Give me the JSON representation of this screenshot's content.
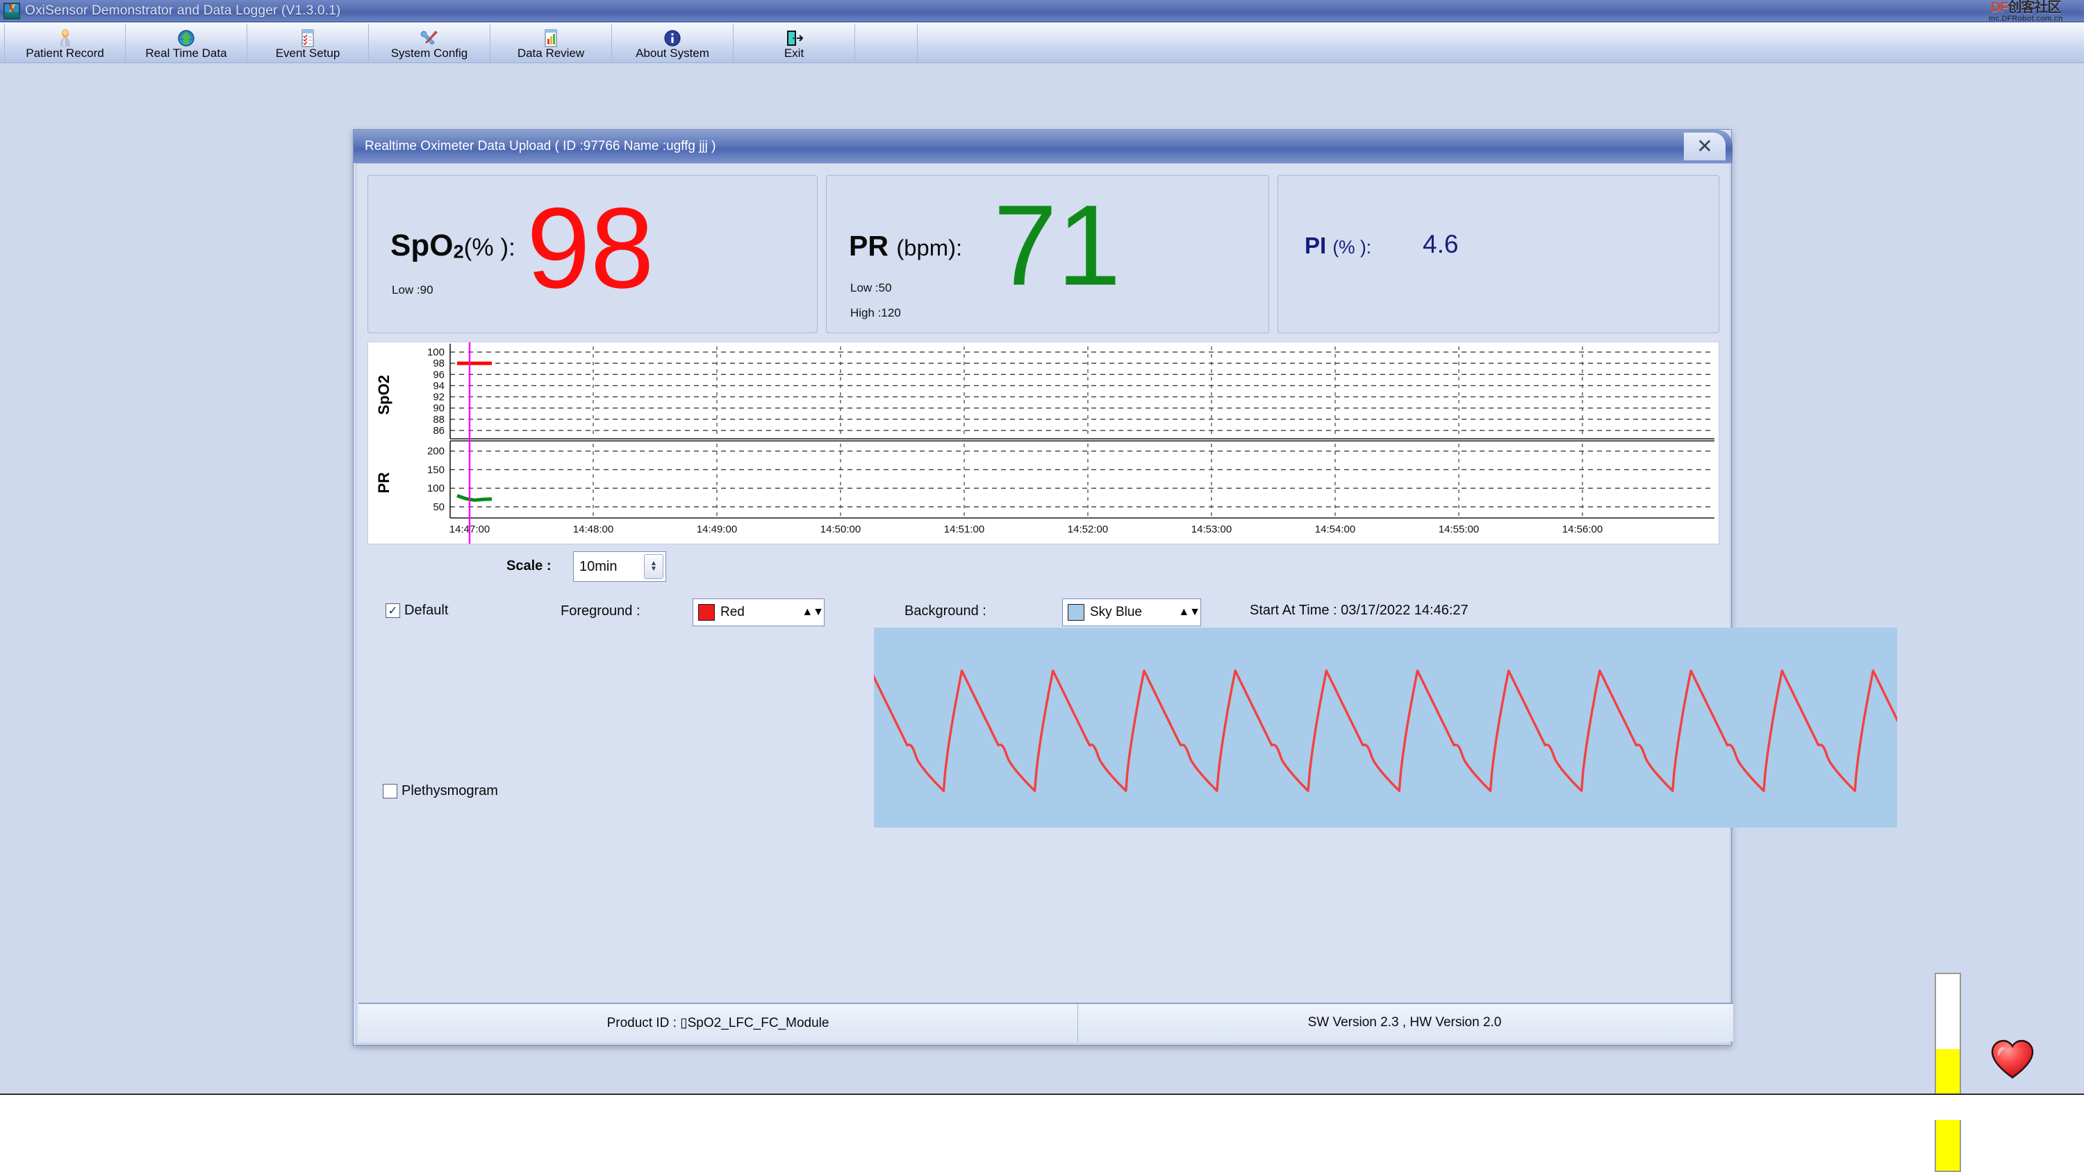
{
  "app": {
    "title": "OxiSensor Demonstrator and Data Logger (V1.3.0.1)",
    "icon": "app-logo-icon"
  },
  "watermark": {
    "brand": "DF",
    "brand_cn": "创客社区",
    "url": "mc.DFRobot.com.cn"
  },
  "toolbar": {
    "items": [
      {
        "label": "Patient Record",
        "icon": "person-icon"
      },
      {
        "label": "Real Time Data",
        "icon": "globe-arrow-icon"
      },
      {
        "label": "Event Setup",
        "icon": "checklist-icon"
      },
      {
        "label": "System Config",
        "icon": "wrench-screwdriver-icon"
      },
      {
        "label": "Data Review",
        "icon": "bar-chart-document-icon"
      },
      {
        "label": "About System",
        "icon": "info-circle-icon"
      },
      {
        "label": "Exit",
        "icon": "exit-door-icon"
      }
    ]
  },
  "dialog": {
    "title": "Realtime Oximeter Data Upload   ( ID :97766   Name :ugffg jjj )",
    "close_label": "✕",
    "patient": {
      "id": "97766",
      "name": "ugffg jjj"
    }
  },
  "readouts": {
    "spo2": {
      "label_main": "SpO",
      "label_sub": "2",
      "label_unit": "(% ):",
      "value": "98",
      "low": "Low :90",
      "color": "#ff0d0d"
    },
    "pr": {
      "label_main": "PR",
      "label_unit": "(bpm):",
      "value": "71",
      "low": "Low :50",
      "high": "High :120",
      "color": "#0f8a19"
    },
    "pi": {
      "label_main": "PI",
      "label_unit": "(% ):",
      "value": "4.6",
      "color": "#141d7a"
    }
  },
  "chart_data": [
    {
      "type": "line",
      "title": "SpO2 trend",
      "ylabel": "SpO2",
      "xlabel": "",
      "ylim": [
        85,
        101
      ],
      "yticks": [
        100,
        98,
        96,
        94,
        92,
        90,
        88,
        86
      ],
      "x": [
        "14:46:27",
        "14:46:40",
        "14:46:55",
        "14:47:10",
        "14:47:20"
      ],
      "values": [
        98,
        98,
        98,
        98,
        98
      ],
      "series_color": "#ff0000",
      "grid": true,
      "cursor_time": "14:47:00",
      "cursor_color": "#ff00ff"
    },
    {
      "type": "line",
      "title": "PR trend",
      "ylabel": "PR",
      "xlabel": "",
      "ylim": [
        20,
        220
      ],
      "yticks": [
        200,
        150,
        100,
        50
      ],
      "x": [
        "14:46:27",
        "14:46:40",
        "14:46:55",
        "14:47:10",
        "14:47:20"
      ],
      "values": [
        80,
        72,
        68,
        70,
        71
      ],
      "series_color": "#0a8a16",
      "grid": true,
      "cursor_time": "14:47:00",
      "cursor_color": "#ff00ff"
    }
  ],
  "chart_axis": {
    "xticks": [
      "14:47:00",
      "14:48:00",
      "14:49:00",
      "14:50:00",
      "14:51:00",
      "14:52:00",
      "14:53:00",
      "14:54:00",
      "14:55:00",
      "14:56:00"
    ]
  },
  "controls": {
    "scale_label": "Scale :",
    "scale_value": "10min",
    "default_checkbox": {
      "label": "Default",
      "checked": true,
      "mark": "✓"
    },
    "pleth_checkbox": {
      "label": "Plethysmogram",
      "checked": false,
      "mark": ""
    },
    "foreground": {
      "label": "Foreground :",
      "value": "Red",
      "color": "#ef1a1a"
    },
    "background": {
      "label": "Background :",
      "value": "Sky Blue",
      "color": "#a6cbe8"
    },
    "start_at_time": "Start At Time : 03/17/2022   14:46:27"
  },
  "pleth": {
    "wave_color": "#f4413f",
    "bg_color": "#a9cceb",
    "beats": 11
  },
  "indicators": {
    "signal_bar_percent": 62,
    "signal_bar_color": "#ffff00",
    "heart_icon": "heart-icon",
    "heart_color": "#f0282d"
  },
  "footer": {
    "product_id": "Product ID : ▯SpO2_LFC_FC_Module",
    "versions": "SW Version 2.3 ,  HW Version 2.0"
  }
}
